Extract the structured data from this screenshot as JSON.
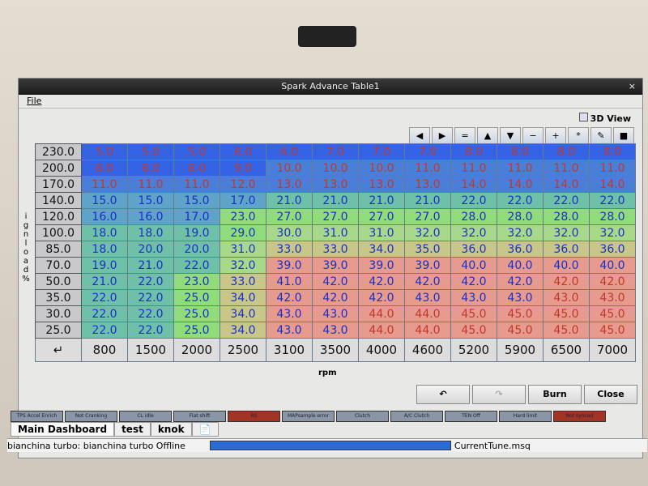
{
  "window": {
    "title": "Spark Advance Table1",
    "close": "×",
    "menu_file": "File",
    "view3d": "3D View"
  },
  "toolbar": [
    "◀",
    "▶",
    "=",
    "▲",
    "▼",
    "−",
    "+",
    "*",
    "✎",
    "■"
  ],
  "axis": {
    "y_label": "ignload%",
    "x_label": "rpm",
    "corner": "↵"
  },
  "chart_data": {
    "type": "table",
    "x": [
      "800",
      "1500",
      "2000",
      "2500",
      "3100",
      "3500",
      "4000",
      "4600",
      "5200",
      "5900",
      "6500",
      "7000"
    ],
    "y": [
      "230.0",
      "200.0",
      "170.0",
      "140.0",
      "120.0",
      "100.0",
      "85.0",
      "70.0",
      "50.0",
      "35.0",
      "30.0",
      "25.0"
    ],
    "values": [
      [
        5,
        5,
        5,
        6,
        6,
        7,
        7,
        7,
        8,
        8,
        8,
        8
      ],
      [
        8,
        8,
        8,
        9,
        10,
        10,
        10,
        11,
        11,
        11,
        11,
        11
      ],
      [
        11,
        11,
        11,
        12,
        13,
        13,
        13,
        13,
        14,
        14,
        14,
        14
      ],
      [
        15,
        15,
        15,
        17,
        21,
        21,
        21,
        21,
        22,
        22,
        22,
        22
      ],
      [
        16,
        16,
        17,
        23,
        27,
        27,
        27,
        27,
        28,
        28,
        28,
        28
      ],
      [
        18,
        18,
        19,
        29,
        30,
        31,
        31,
        32,
        32,
        32,
        32,
        32
      ],
      [
        18,
        20,
        20,
        31,
        33,
        33,
        34,
        35,
        36,
        36,
        36,
        36
      ],
      [
        19,
        21,
        22,
        32,
        39,
        39,
        39,
        39,
        40,
        40,
        40,
        40
      ],
      [
        21,
        22,
        23,
        33,
        41,
        42,
        42,
        42,
        42,
        42,
        42,
        42
      ],
      [
        22,
        22,
        25,
        34,
        42,
        42,
        42,
        43,
        43,
        43,
        43,
        43
      ],
      [
        22,
        22,
        25,
        34,
        43,
        43,
        44,
        44,
        45,
        45,
        45,
        45
      ],
      [
        22,
        22,
        25,
        34,
        43,
        43,
        44,
        44,
        45,
        45,
        45,
        45
      ]
    ]
  },
  "buttons": {
    "undo": "↶",
    "redo": "↷",
    "burn": "Burn",
    "close": "Close"
  },
  "indicators": [
    {
      "label": "TPS Accel Enrich",
      "on": false
    },
    {
      "label": "Not Cranking",
      "on": false
    },
    {
      "label": "CL idle",
      "on": false
    },
    {
      "label": "Flat shift",
      "on": false
    },
    {
      "label": "RS",
      "on": true
    },
    {
      "label": "MAPsample error",
      "on": false
    },
    {
      "label": "Clutch",
      "on": false
    },
    {
      "label": "A/C Clutch",
      "on": false
    },
    {
      "label": "TEN Off",
      "on": false
    },
    {
      "label": "Hard limit",
      "on": false
    },
    {
      "label": "Not synced",
      "on": true
    }
  ],
  "tabs": [
    "Main Dashboard",
    "test",
    "knok",
    "📄"
  ],
  "status": {
    "connection": "bianchina turbo: bianchina turbo Offline",
    "file": "CurrentTune.msq",
    "progress": 1.0
  }
}
